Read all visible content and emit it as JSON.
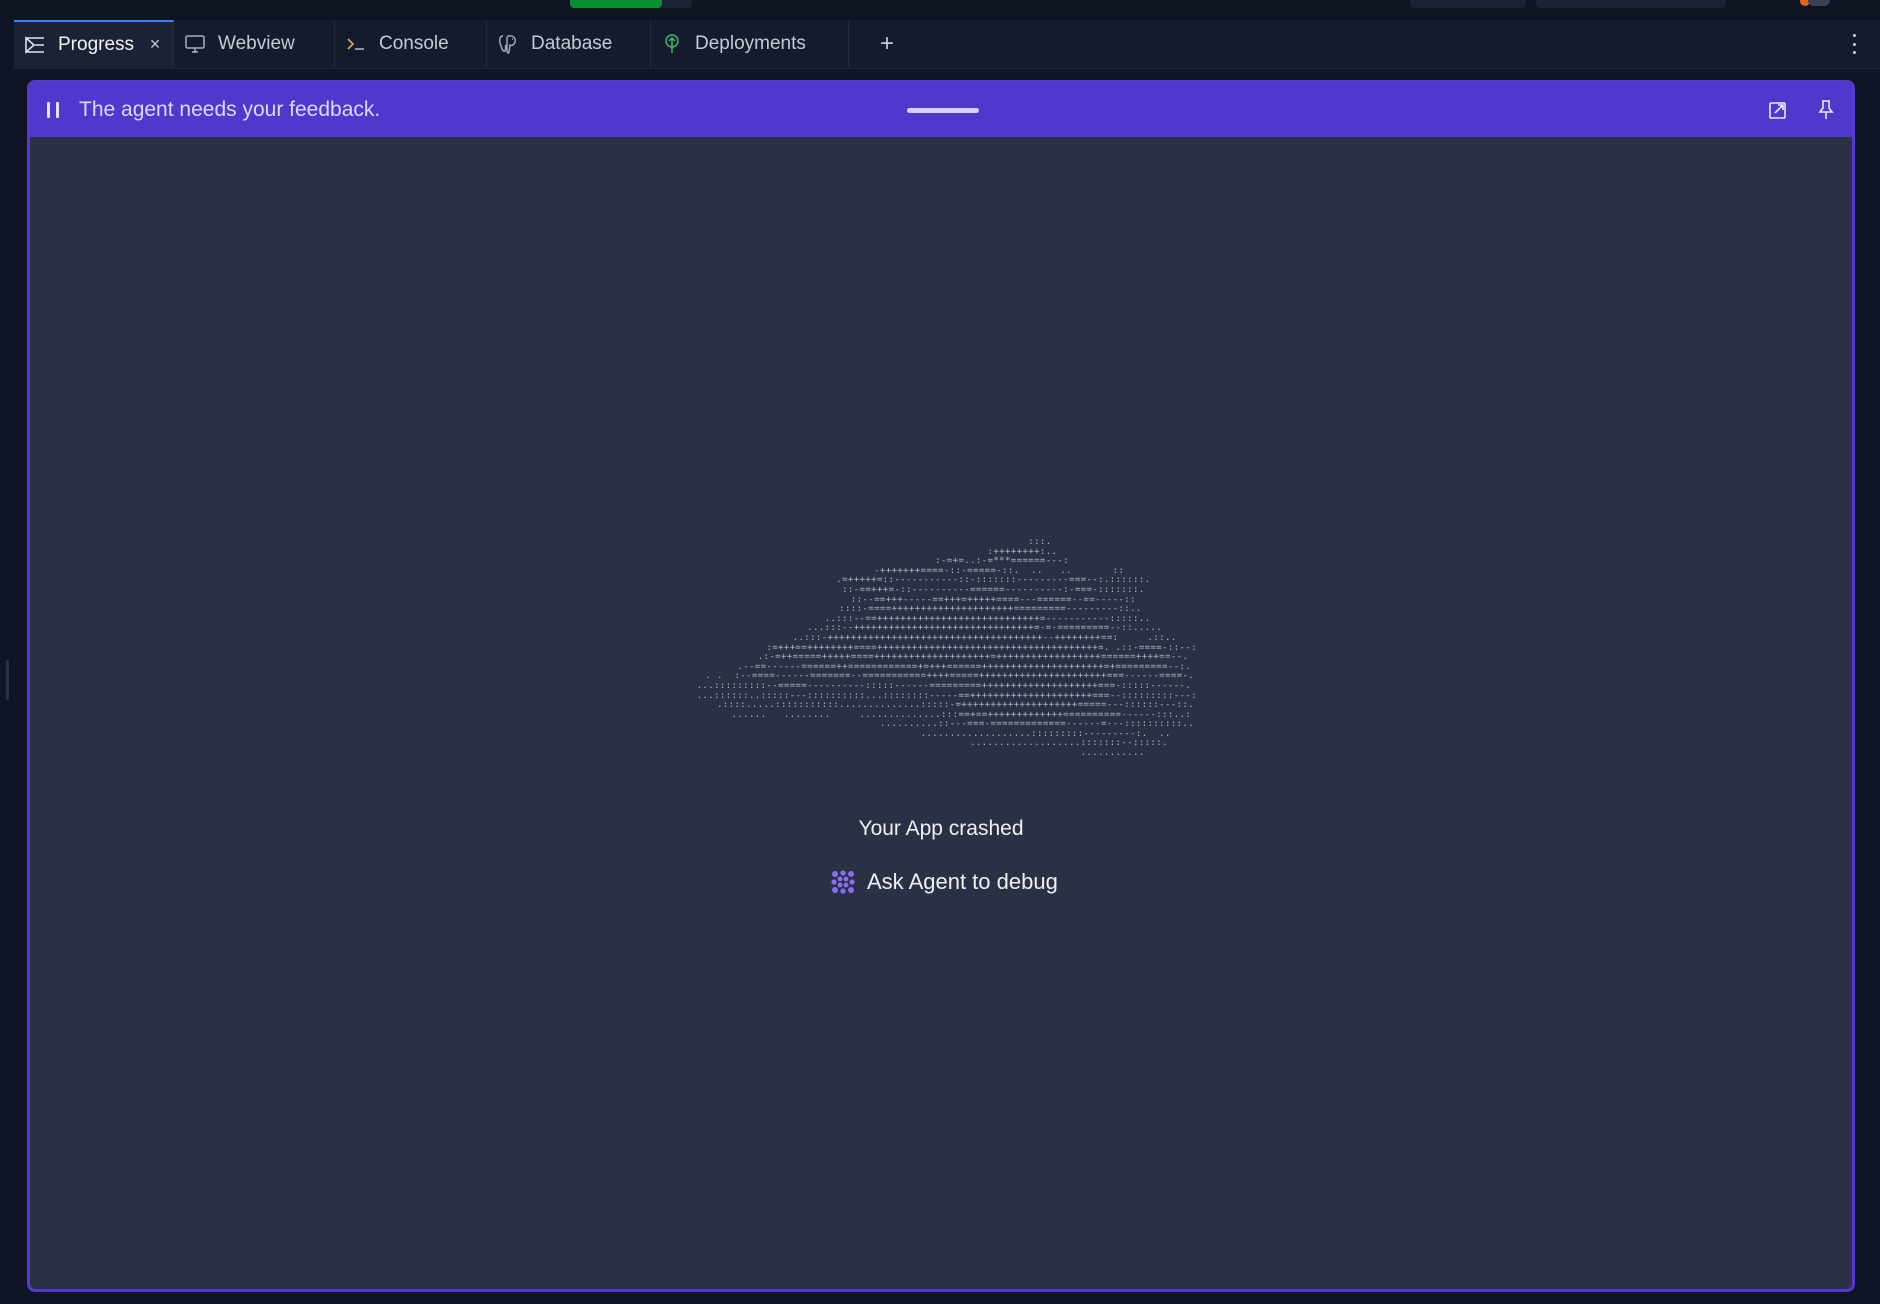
{
  "tabs": [
    {
      "label": "Progress",
      "icon": "progress-icon",
      "active": true
    },
    {
      "label": "Webview",
      "icon": "monitor-icon"
    },
    {
      "label": "Console",
      "icon": "terminal-icon"
    },
    {
      "label": "Database",
      "icon": "postgres-icon"
    },
    {
      "label": "Deployments",
      "icon": "deployments-icon"
    }
  ],
  "add_tab_label": "+",
  "banner": {
    "message": "The agent needs your feedback.",
    "color": "#5138cd"
  },
  "crash": {
    "title": "Your App crashed",
    "debug_button": "Ask Agent to debug",
    "accent": "#8b6cf6"
  },
  "ascii_art": "                                  :::.\n                            :++++++++:..\n                     :-=+=..:-=***======---:\n                    -+++++++====-::-=====-::.  ..   ..       ::\n                  .=+++++=::-----------::-:::::::---------===--:.::::::.\n                  ::-==+++=-::----------======----------:-===-:::::::.\n                  ::--==+++-----==+++=+++++====---======--==-----::\n                 ::::-====+++++++++++++++++++++=========---------::..\n                ..:::--==++++++++++++++++++++++++++++=-----------:::::..\n               ...:::--+++++++++++++++++++++++++++++++=-=-=========--::.....\n               ..:::-+++++++++++++++++++++++++++++++++++++--++++++++==:     .::..\n              :=+++==++++++++====++++++++++++++++++++++++++++++++++++++=. .::-====-::--:\n           .:-=++=====+++++====++++++++++++++++++++=++++++++++++++++++======++++==--.\n        .--==------======++============+=+++======+++++++++++++++++++++=+=========--:.\n   . .  :--====------=======--===========++++=====++++++++++++++++++++++===------====-.\n ...:::::::::--=====----------:::::------=========++++++++++++++++++++===-:::::------.\n  ...::::::..:::::---::::::::::...::::::::-----==+++++++++++++++++++++===--:::::::::---:\n     .::::.....:::::::::::..............:::::-=++++++++++++++++++++=====---::::::---::.\n       ......   ........     ..............:::==+==+++++++++++++==========------:::..:\n                                 ..........::---===-=============------=---::::::::::..\n                                    ...................:::::::::---------:.  ..\n                                            ...................:::::::--:::::.\n                                                           ..........."
}
